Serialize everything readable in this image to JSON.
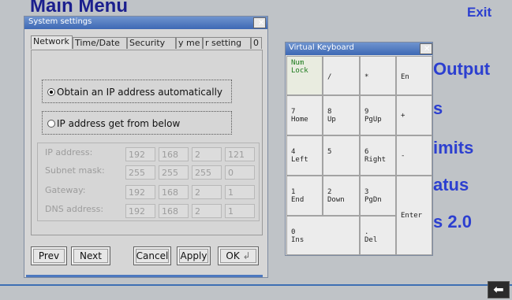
{
  "background": {
    "title": "Main Menu",
    "exit_label": "Exit",
    "menu_items": [
      "Output",
      "s",
      "imits",
      "atus",
      "s 2.0"
    ]
  },
  "dialog": {
    "title": "System settings",
    "tabs": [
      "Network",
      "Time/Date",
      "Security",
      "y me",
      "r setting",
      "0"
    ],
    "radio_auto_label": "Obtain an IP address automatically",
    "radio_manual_label": "IP address get from below",
    "fields": [
      {
        "label": "IP address:",
        "values": [
          "192",
          "168",
          "2",
          "121"
        ]
      },
      {
        "label": "Subnet mask:",
        "values": [
          "255",
          "255",
          "255",
          "0"
        ]
      },
      {
        "label": "Gateway:",
        "values": [
          "192",
          "168",
          "2",
          "1"
        ]
      },
      {
        "label": "DNS address:",
        "values": [
          "192",
          "168",
          "2",
          "1"
        ]
      }
    ],
    "buttons": {
      "prev": "Prev",
      "next": "Next",
      "cancel": "Cancel",
      "apply": "Apply",
      "ok": "OK"
    }
  },
  "keyboard": {
    "title": "Virtual Keyboard",
    "keys": {
      "numlock": "Num\nLock",
      "slash": "/",
      "star": "*",
      "en": "En",
      "k7": "7\nHome",
      "k8": "8\nUp",
      "k9": "9\nPgUp",
      "plus": "+",
      "k4": "4\nLeft",
      "k5": "5",
      "k6": "6\nRight",
      "minus": "-",
      "k1": "1\nEnd",
      "k2": "2\nDown",
      "k3": "3\nPgDn",
      "enter": "Enter",
      "k0": "0\nIns",
      "del": ".\nDel"
    }
  },
  "colors": {
    "title_bar": "#3d68b4",
    "menu_text": "#2c3fd0",
    "numlock_text": "#1c7a1c"
  }
}
